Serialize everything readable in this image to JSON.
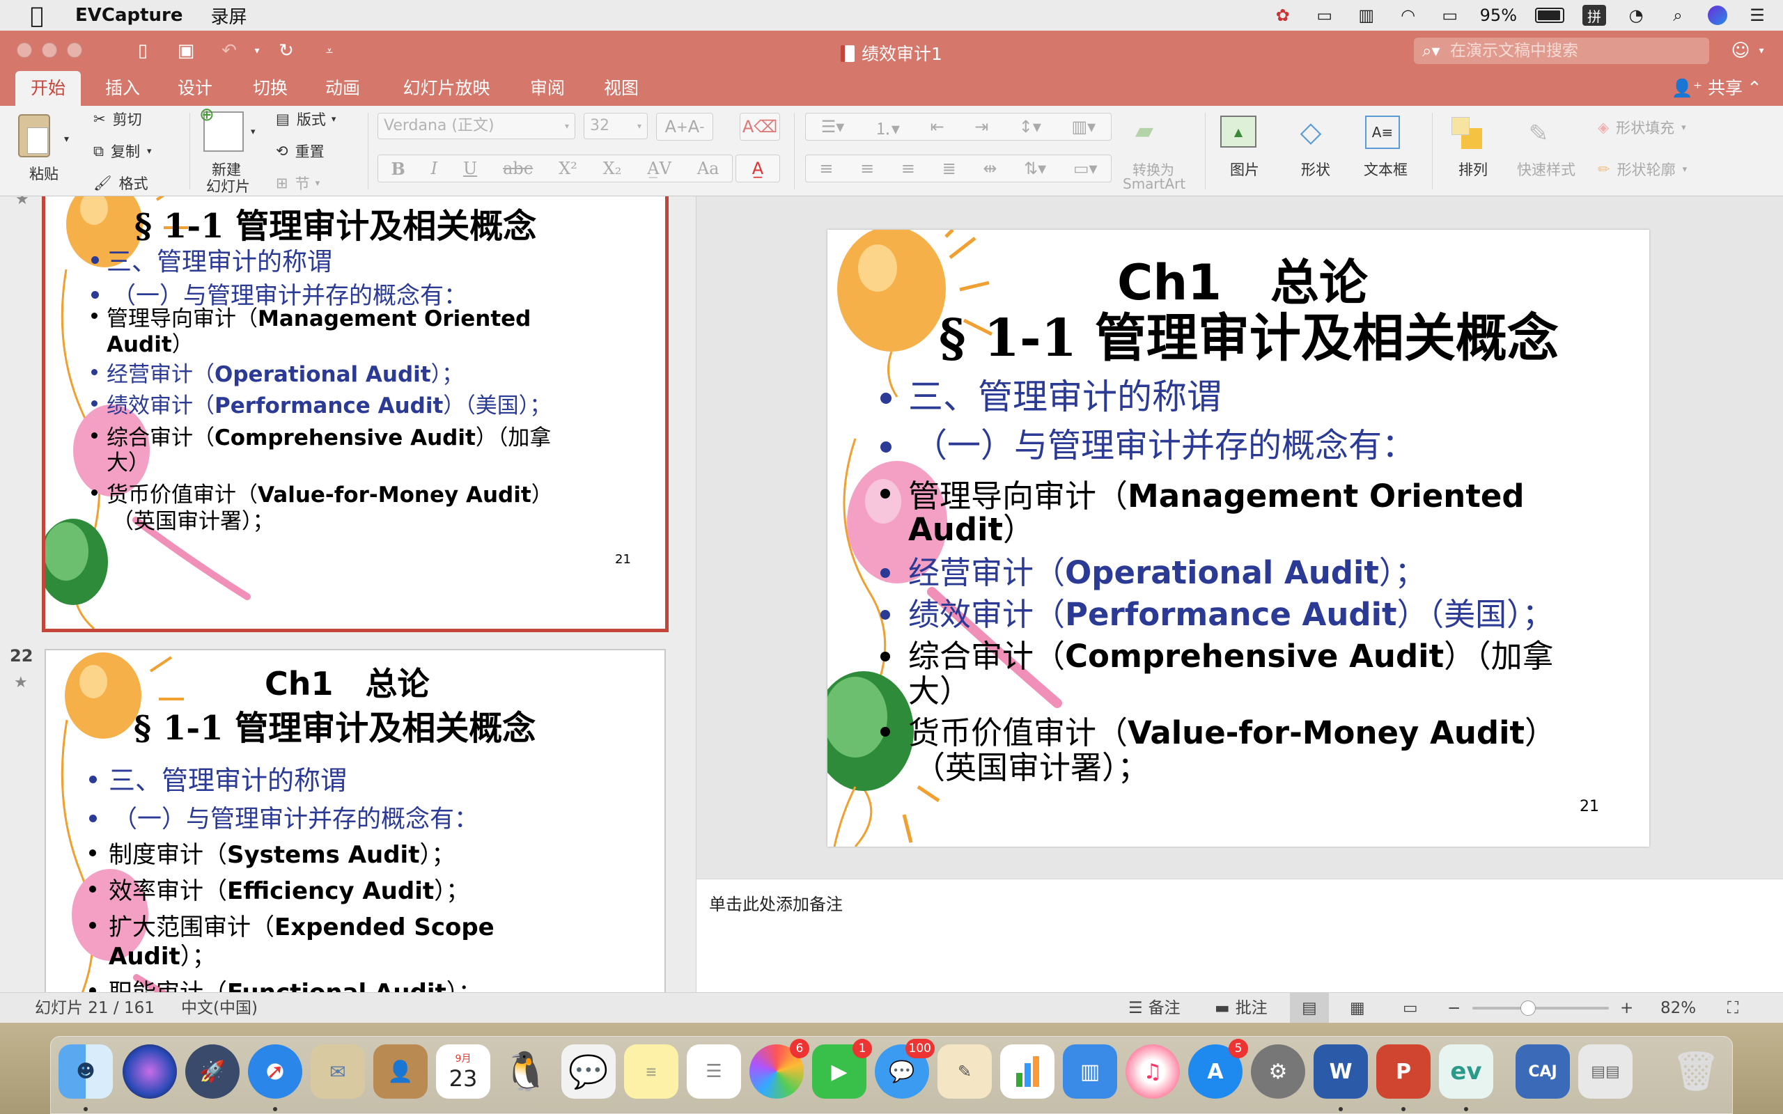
{
  "menubar": {
    "app_name": "EVCapture",
    "menu_label": "录屏",
    "battery_percent": "95%",
    "input_method": "拼"
  },
  "window": {
    "title": "绩效审计1",
    "search_placeholder": "在演示文稿中搜索"
  },
  "ribbon_tabs": [
    "开始",
    "插入",
    "设计",
    "切换",
    "动画",
    "幻灯片放映",
    "审阅",
    "视图"
  ],
  "share_label": "共享",
  "ribbon": {
    "paste": "粘贴",
    "cut": "剪切",
    "copy": "复制",
    "format": "格式",
    "new_slide_line1": "新建",
    "new_slide_line2": "幻灯片",
    "layout": "版式",
    "reset": "重置",
    "section": "节",
    "font_name": "Verdana (正文)",
    "font_size": "32",
    "convert_smartart_line1": "转换为",
    "convert_smartart_line2": "SmartArt",
    "picture": "图片",
    "shape": "形状",
    "textbox": "文本框",
    "arrange": "排列",
    "quick_styles": "快速样式",
    "shape_fill": "形状填充",
    "shape_outline": "形状轮廓"
  },
  "slide21": {
    "number": "21",
    "title_line1": "Ch1　总论",
    "title_line2": "§ 1-1 管理审计及相关概念",
    "heading1": "三、管理审计的称谓",
    "heading2": "（一）与管理审计并存的概念有：",
    "item1_cn": "管理导向审计（",
    "item1_en": "Management Oriented",
    "item1_cont_en": "Audit",
    "item1_cont_cn": "）",
    "item2_cn": "经营审计（",
    "item2_en": "Operational Audit",
    "item2_end": "）；",
    "item3_cn": "绩效审计（",
    "item3_en": "Performance Audit",
    "item3_end": "）（美国）；",
    "item4_cn": "综合审计（",
    "item4_en": "Comprehensive Audit",
    "item4_end": "）（加拿",
    "item4_cont": "大）",
    "item5_cn": "货币价值审计（",
    "item5_en": "Value-for-Money Audit",
    "item5_end": "）",
    "item5_cont": "（英国审计署）；",
    "page_number": "21"
  },
  "slide22": {
    "number": "22",
    "title_line1": "Ch1　总论",
    "title_line2": "§ 1-1 管理审计及相关概念",
    "heading1": "三、管理审计的称谓",
    "heading2": "（一）与管理审计并存的概念有：",
    "item1_cn": "制度审计（",
    "item1_en": "Systems Audit",
    "item1_end": "）；",
    "item2_cn": "效率审计（",
    "item2_en": "Efficiency Audit",
    "item2_end": "）；",
    "item3_cn": "扩大范围审计（",
    "item3_en": "Expended Scope",
    "item3_cont_en": "Audit",
    "item3_cont_end": "）；",
    "item4_cn": "职能审计（",
    "item4_en": "Functional Audit",
    "item4_end": "）；"
  },
  "notes_placeholder": "单击此处添加备注",
  "status": {
    "slide_counter": "幻灯片 21 / 161",
    "language": "中文(中国)",
    "notes_button": "备注",
    "comments_button": "批注",
    "zoom_level": "82%",
    "zoom_fraction": 0.41
  },
  "dock": {
    "calendar_month": "9月",
    "calendar_day": "23",
    "badge_photos": "6",
    "badge_facetime": "1",
    "badge_messages": "100",
    "badge_appstore": "5",
    "word_letter": "W",
    "ppt_letter": "P",
    "caj_label": "CAJ"
  },
  "colors": {
    "accent": "#d5776a",
    "slide_blue": "#2b3a94",
    "selected_border": "#c4463a"
  }
}
